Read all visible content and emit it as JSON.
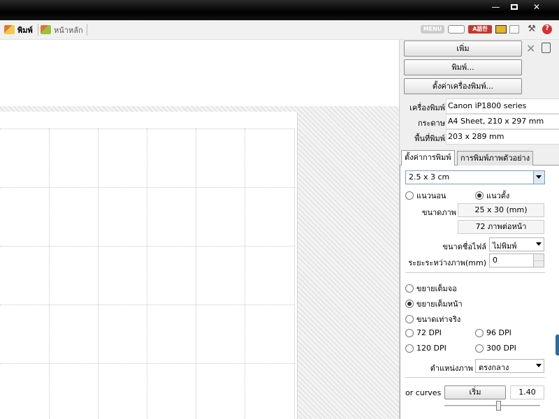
{
  "window": {
    "minimize_glyph": "—",
    "close_glyph": "✕"
  },
  "toolbar": {
    "tab_print": "พิมพ์",
    "tab_home": "หน้าหลัก",
    "menu_label": "MENU",
    "lang_label": "A語한",
    "help_glyph": "?",
    "tools_glyph": "⚒"
  },
  "panel": {
    "add_button": "เพิ่ม",
    "print_button": "พิมพ์...",
    "printer_setup_button": "ตั้งค่าเครื่องพิมพ์...",
    "printer_label": "เครื่องพิมพ์",
    "printer_value": "Canon iP1800 series",
    "paper_label": "กระดาษ",
    "paper_value": "A4 Sheet, 210 x 297 mm",
    "area_label": "พื้นที่พิมพ์",
    "area_value": "203 x 289 mm",
    "tabs": [
      "ตั้งค่าการพิมพ์",
      "การพิมพ์ภาพตัวอย่าง"
    ],
    "size_option": "2.5 x 3 cm",
    "orientation_landscape": "แนวนอน",
    "orientation_portrait": "แนวตั้ง",
    "orientation_selected": "portrait",
    "image_size_label": "ขนาดภาพ",
    "image_size_value": "25 x 30 (mm)",
    "per_page_value": "72 ภาพต่อหน้า",
    "filename_size_label": "ขนาดชื่อไฟล์",
    "filename_size_value": "ไม่พิมพ์",
    "spacing_label": "ระยะระหว่างภาพ(mm)",
    "spacing_value": "0",
    "fit_screen": "ขยายเต็มจอ",
    "fit_page": "ขยายเต็มหน้า",
    "actual_size": "ขนาดเท่าจริง",
    "dpi_72": "72 DPI",
    "dpi_96": "96 DPI",
    "dpi_120": "120 DPI",
    "dpi_300": "300 DPI",
    "scale_selected": "fit_page",
    "position_label": "ตำแหน่งภาพ",
    "position_value": "ตรงกลาง",
    "curves_label": "or curves",
    "start_button": "เริ่ม",
    "curves_value": "1.40"
  },
  "icons": {
    "tab_print": "printer-icon",
    "tab_home": "home-icon",
    "cross": "cross-icon",
    "trash": "trash-icon"
  }
}
